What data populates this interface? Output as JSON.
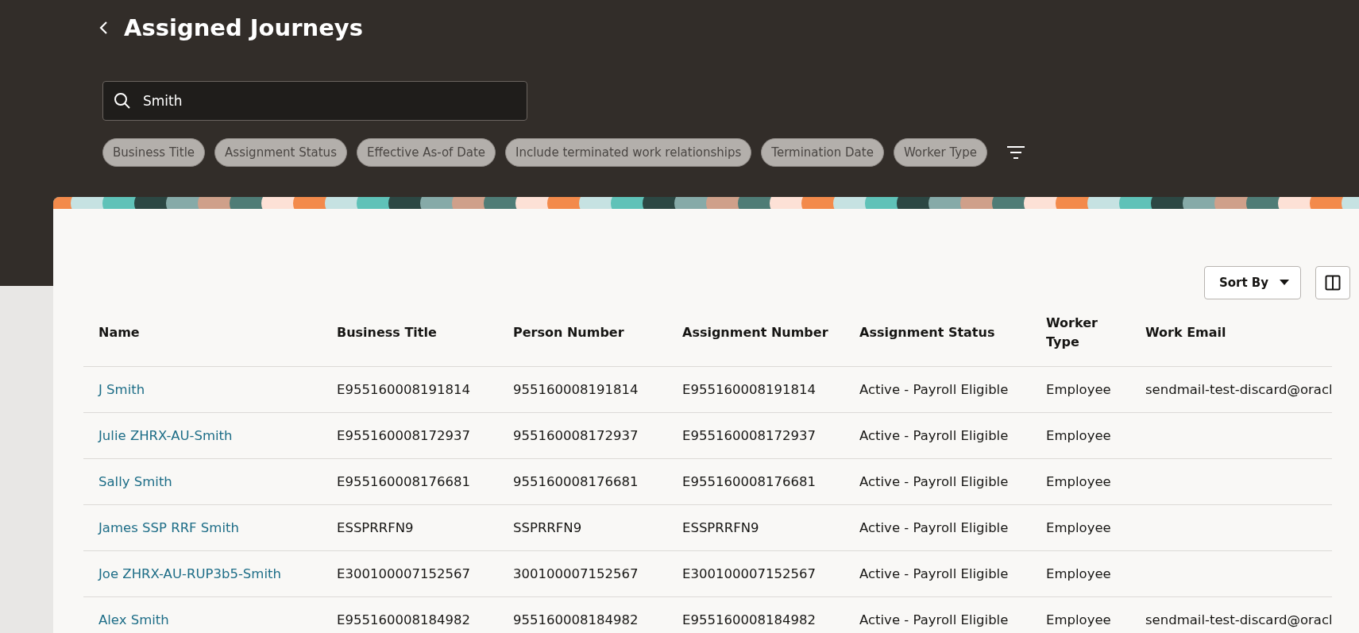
{
  "page": {
    "title": "Assigned Journeys"
  },
  "search": {
    "value": "Smith"
  },
  "filters": [
    {
      "label": "Business Title"
    },
    {
      "label": "Assignment Status"
    },
    {
      "label": "Effective As-of Date"
    },
    {
      "label": "Include terminated work relationships"
    },
    {
      "label": "Termination Date"
    },
    {
      "label": "Worker Type"
    }
  ],
  "toolbar": {
    "sort_label": "Sort By"
  },
  "table": {
    "columns": [
      "Name",
      "Business Title",
      "Person Number",
      "Assignment Number",
      "Assignment Status",
      "Worker Type",
      "Work Email"
    ],
    "rows": [
      [
        "J Smith",
        "E955160008191814",
        "955160008191814",
        "E955160008191814",
        "Active - Payroll Eligible",
        "Employee",
        "sendmail-test-discard@oracl"
      ],
      [
        "Julie ZHRX-AU-Smith",
        "E955160008172937",
        "955160008172937",
        "E955160008172937",
        "Active - Payroll Eligible",
        "Employee",
        ""
      ],
      [
        "Sally Smith",
        "E955160008176681",
        "955160008176681",
        "E955160008176681",
        "Active - Payroll Eligible",
        "Employee",
        ""
      ],
      [
        "James SSP RRF Smith",
        "ESSPRRFN9",
        "SSPRRFN9",
        "ESSPRRFN9",
        "Active - Payroll Eligible",
        "Employee",
        ""
      ],
      [
        "Joe ZHRX-AU-RUP3b5-Smith",
        "E300100007152567",
        "300100007152567",
        "E300100007152567",
        "Active - Payroll Eligible",
        "Employee",
        ""
      ],
      [
        "Alex Smith",
        "E955160008184982",
        "955160008184982",
        "E955160008184982",
        "Active - Payroll Eligible",
        "Employee",
        "sendmail-test-discard@oracl"
      ]
    ]
  }
}
